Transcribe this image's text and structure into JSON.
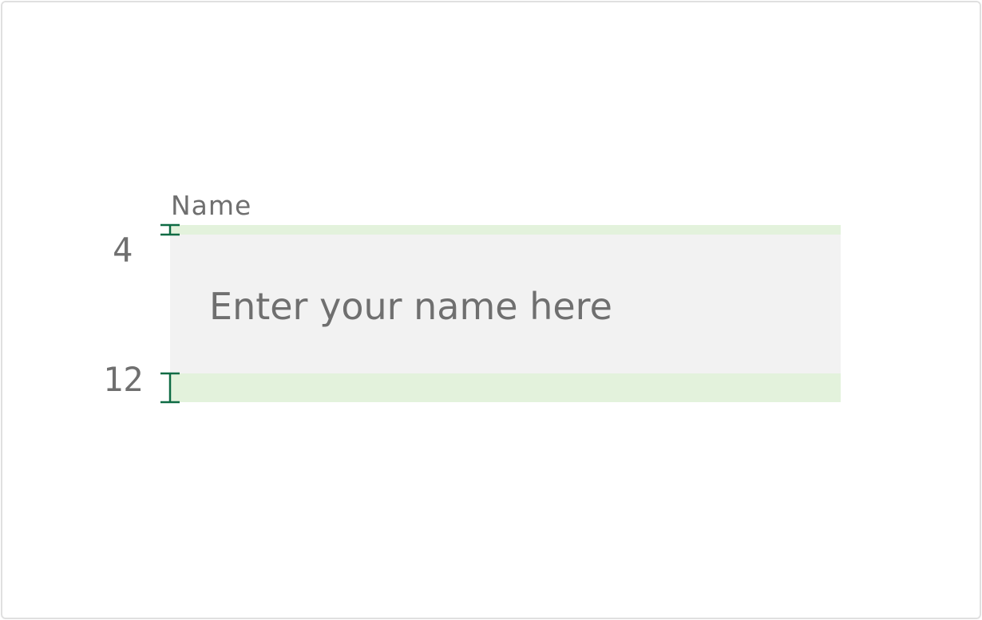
{
  "field": {
    "label": "Name",
    "placeholder": "Enter your name here"
  },
  "annotations": {
    "top_spacing": "4",
    "bottom_spacing": "12"
  },
  "colors": {
    "spacing_highlight": "#e3f2dc",
    "field_background": "#f2f2f2",
    "measure_marker": "#0e6b44",
    "text": "#6f6f6f"
  }
}
